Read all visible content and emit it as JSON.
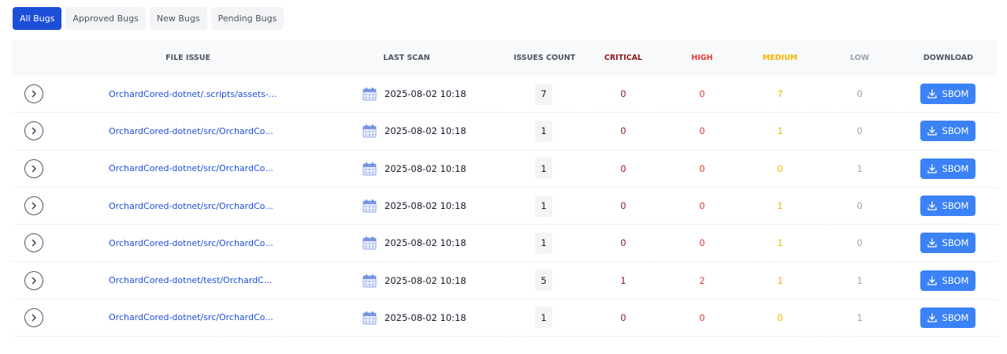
{
  "tabs": [
    {
      "label": "All Bugs",
      "active": true
    },
    {
      "label": "Approved Bugs",
      "active": false
    },
    {
      "label": "New Bugs",
      "active": false
    },
    {
      "label": "Pending Bugs",
      "active": false
    }
  ],
  "columns": {
    "file_issue": "FILE ISSUE",
    "last_scan": "LAST SCAN",
    "issues_count": "ISSUES COUNT",
    "critical": "CRITICAL",
    "high": "HIGH",
    "medium": "MEDIUM",
    "low": "LOW",
    "download": "DOWNLOAD"
  },
  "colors": {
    "critical": "#8b1a1a",
    "high": "#e53935",
    "medium": "#f5b400",
    "low": "#9ca3af",
    "header_text": "#4b5563",
    "accent": "#3b82f6"
  },
  "rows": [
    {
      "file": "OrchardCored-dotnet/.scripts/assets-...",
      "last_scan": "2025-08-02 10:18",
      "count": "7",
      "critical": "0",
      "high": "0",
      "medium": "7",
      "low": "0",
      "download": "SBOM"
    },
    {
      "file": "OrchardCored-dotnet/src/OrchardCo...",
      "last_scan": "2025-08-02 10:18",
      "count": "1",
      "critical": "0",
      "high": "0",
      "medium": "1",
      "low": "0",
      "download": "SBOM"
    },
    {
      "file": "OrchardCored-dotnet/src/OrchardCo...",
      "last_scan": "2025-08-02 10:18",
      "count": "1",
      "critical": "0",
      "high": "0",
      "medium": "0",
      "low": "1",
      "download": "SBOM"
    },
    {
      "file": "OrchardCored-dotnet/src/OrchardCo...",
      "last_scan": "2025-08-02 10:18",
      "count": "1",
      "critical": "0",
      "high": "0",
      "medium": "1",
      "low": "0",
      "download": "SBOM"
    },
    {
      "file": "OrchardCored-dotnet/src/OrchardCo...",
      "last_scan": "2025-08-02 10:18",
      "count": "1",
      "critical": "0",
      "high": "0",
      "medium": "1",
      "low": "0",
      "download": "SBOM"
    },
    {
      "file": "OrchardCored-dotnet/test/OrchardC...",
      "last_scan": "2025-08-02 10:18",
      "count": "5",
      "critical": "1",
      "high": "2",
      "medium": "1",
      "low": "1",
      "download": "SBOM"
    },
    {
      "file": "OrchardCored-dotnet/src/OrchardCo...",
      "last_scan": "2025-08-02 10:18",
      "count": "1",
      "critical": "0",
      "high": "0",
      "medium": "0",
      "low": "1",
      "download": "SBOM"
    }
  ],
  "icons": {
    "expand": "chevron-right-icon",
    "scan": "calendar-icon",
    "download": "download-icon"
  }
}
